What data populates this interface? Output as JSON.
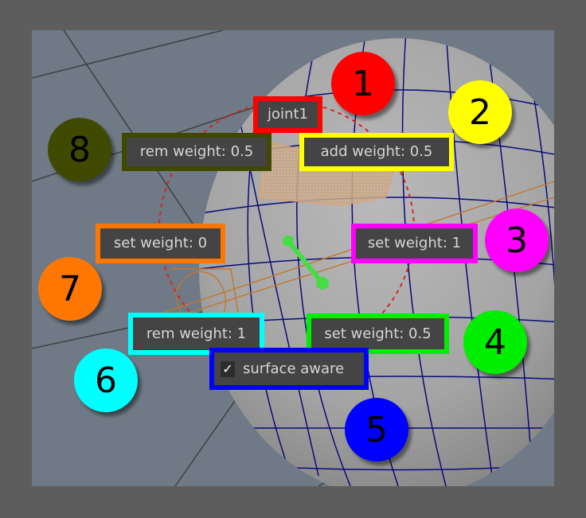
{
  "labels": {
    "joint": "joint1",
    "add_weight": "add weight: 0.5",
    "rem_weight_half": "rem weight: 0.5",
    "set_weight_one": "set weight: 1",
    "set_weight_zero": "set weight: 0",
    "rem_weight_one": "rem weight: 1",
    "set_weight_half": "set weight: 0.5",
    "surface_aware": "surface aware"
  },
  "surface_aware_checked": true,
  "badges": [
    "1",
    "2",
    "3",
    "4",
    "5",
    "6",
    "7",
    "8"
  ],
  "colors": {
    "badge1": "#ff0000",
    "badge2": "#ffff00",
    "badge3": "#ff00ff",
    "badge4": "#00ee00",
    "badge5": "#0000ff",
    "badge6": "#00ffff",
    "badge7": "#ff7700",
    "badge8": "#3f4a00",
    "wire": "#0a0a7a",
    "joint_bone": "#44dd44"
  },
  "icons": {
    "checkbox": "check-mark-icon"
  }
}
